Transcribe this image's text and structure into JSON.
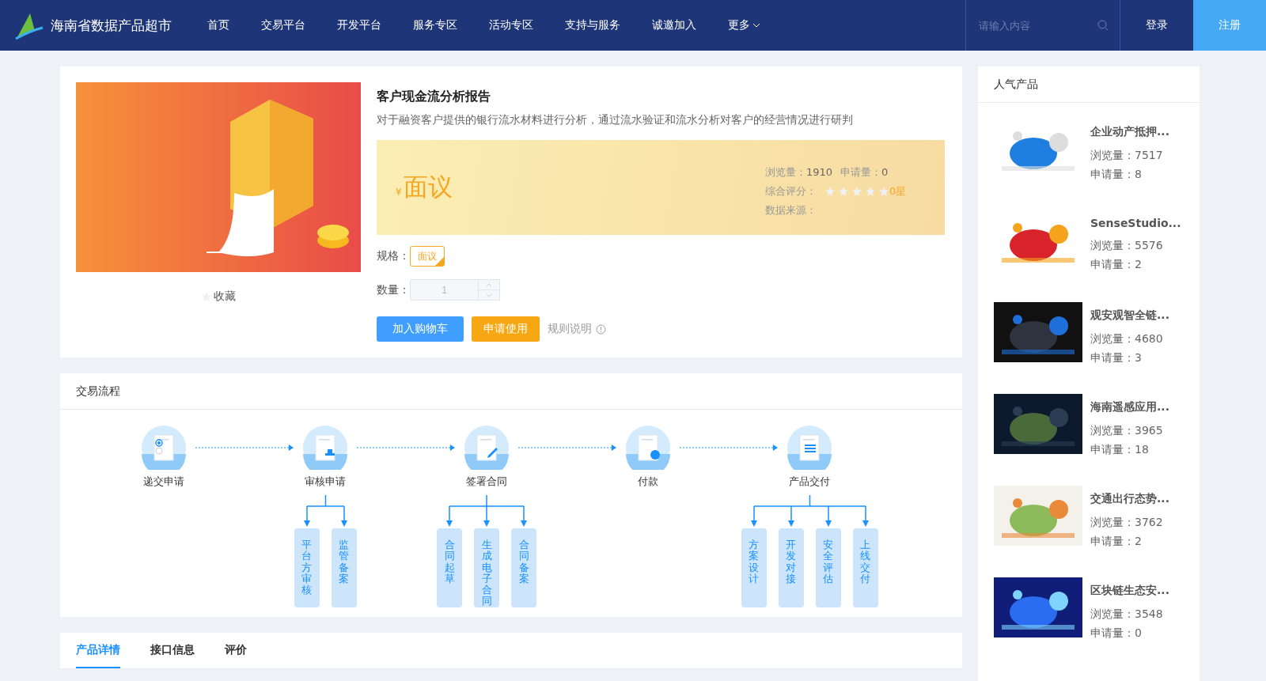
{
  "header": {
    "brand": "海南省数据产品超市",
    "nav": [
      {
        "label": "首页",
        "dropdown": false
      },
      {
        "label": "交易平台",
        "dropdown": false
      },
      {
        "label": "开发平台",
        "dropdown": false
      },
      {
        "label": "服务专区",
        "dropdown": false
      },
      {
        "label": "活动专区",
        "dropdown": false
      },
      {
        "label": "支持与服务",
        "dropdown": false
      },
      {
        "label": "诚邀加入",
        "dropdown": false
      },
      {
        "label": "更多",
        "dropdown": true
      }
    ],
    "search": {
      "placeholder": "请输入内容"
    },
    "login": "登录",
    "register": "注册"
  },
  "product": {
    "title": "客户现金流分析报告",
    "description": "对于融资客户提供的银行流水材料进行分析，通过流水验证和流水分析对客户的经营情况进行研判",
    "favorite": {
      "label": "收藏",
      "checked": false
    },
    "price": {
      "currency": "¥",
      "value": "面议"
    },
    "stats": {
      "views_label": "浏览量：",
      "views": "1910",
      "requests_label": "申请量：",
      "requests": "0",
      "rating_label": "综合评分：",
      "stars": 0,
      "rating_text": "0星",
      "source_label": "数据来源："
    },
    "spec": {
      "label": "规格：",
      "options": [
        {
          "label": "面议",
          "selected": true
        }
      ]
    },
    "quantity": {
      "label": "数量：",
      "value": "1"
    },
    "buttons": {
      "cart": "加入购物车",
      "apply": "申请使用",
      "rules": "规则说明"
    }
  },
  "flow": {
    "title": "交易流程",
    "steps": [
      {
        "label": "递交申请"
      },
      {
        "label": "审核申请",
        "children": [
          {
            "label": "平台方审核"
          },
          {
            "label": "监管备案"
          }
        ]
      },
      {
        "label": "签署合同",
        "children": [
          {
            "label": "合同起草"
          },
          {
            "label": "生成电子合同"
          },
          {
            "label": "合同备案"
          }
        ]
      },
      {
        "label": "付款"
      },
      {
        "label": "产品交付",
        "children": [
          {
            "label": "方案设计"
          },
          {
            "label": "开发对接"
          },
          {
            "label": "安全评估"
          },
          {
            "label": "上线交付"
          }
        ]
      }
    ]
  },
  "tabs": [
    {
      "label": "产品详情",
      "selected": true
    },
    {
      "label": "接口信息",
      "selected": false
    },
    {
      "label": "评价",
      "selected": false
    }
  ],
  "popular": {
    "title": "人气产品",
    "items": [
      {
        "name": "企业动产抵押...",
        "views": "浏览量：7517",
        "requests": "申请量：8",
        "kind": "picture"
      },
      {
        "name": "SenseStudio...",
        "views": "浏览量：5576",
        "requests": "申请量：2",
        "kind": "picture"
      },
      {
        "name": "观安观智全链...",
        "views": "浏览量：4680",
        "requests": "申请量：3",
        "kind": "picture"
      },
      {
        "name": "海南遥感应用...",
        "views": "浏览量：3965",
        "requests": "申请量：18",
        "kind": "picture"
      },
      {
        "name": "交通出行态势...",
        "views": "浏览量：3762",
        "requests": "申请量：2",
        "kind": "picture"
      },
      {
        "name": "区块链生态安...",
        "views": "浏览量：3548",
        "requests": "申请量：0",
        "kind": "picture"
      }
    ]
  }
}
